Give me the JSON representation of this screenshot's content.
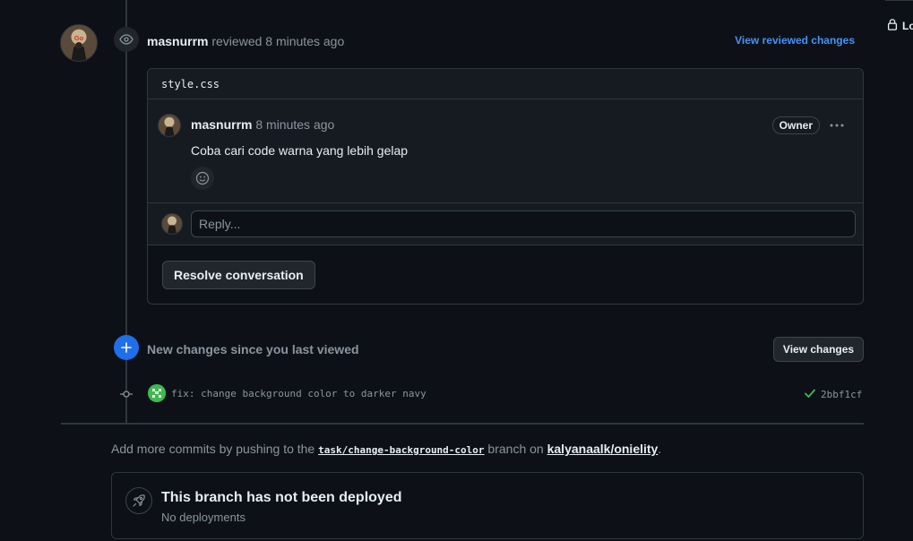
{
  "review": {
    "author": "masnurrm",
    "action": " reviewed ",
    "time": "8 minutes ago",
    "view_reviewed_label": "View reviewed changes"
  },
  "sidebar_right": {
    "lock_label": "Lo"
  },
  "file": {
    "name": "style.css"
  },
  "comment": {
    "author": "masnurrm",
    "time": "8 minutes ago",
    "role_badge": "Owner",
    "body": "Coba cari code warna yang lebih gelap"
  },
  "reply": {
    "placeholder": "Reply..."
  },
  "resolve_label": "Resolve conversation",
  "new_changes": {
    "text": "New changes since you last viewed",
    "button_label": "View changes"
  },
  "commit": {
    "message": "fix: change background color to darker navy",
    "sha": "2bbf1cf",
    "status": "success"
  },
  "push_note": {
    "prefix": "Add more commits by pushing to the ",
    "branch": "task/change-background-color",
    "middle": " branch on ",
    "repo": "kalyanaalk/onielity",
    "suffix": "."
  },
  "deployment": {
    "title": "This branch has not been deployed",
    "subtitle": "No deployments"
  },
  "colors": {
    "background": "#0d1117",
    "accent": "#4493f8",
    "success": "#3fb950",
    "muted": "#8b949e"
  }
}
